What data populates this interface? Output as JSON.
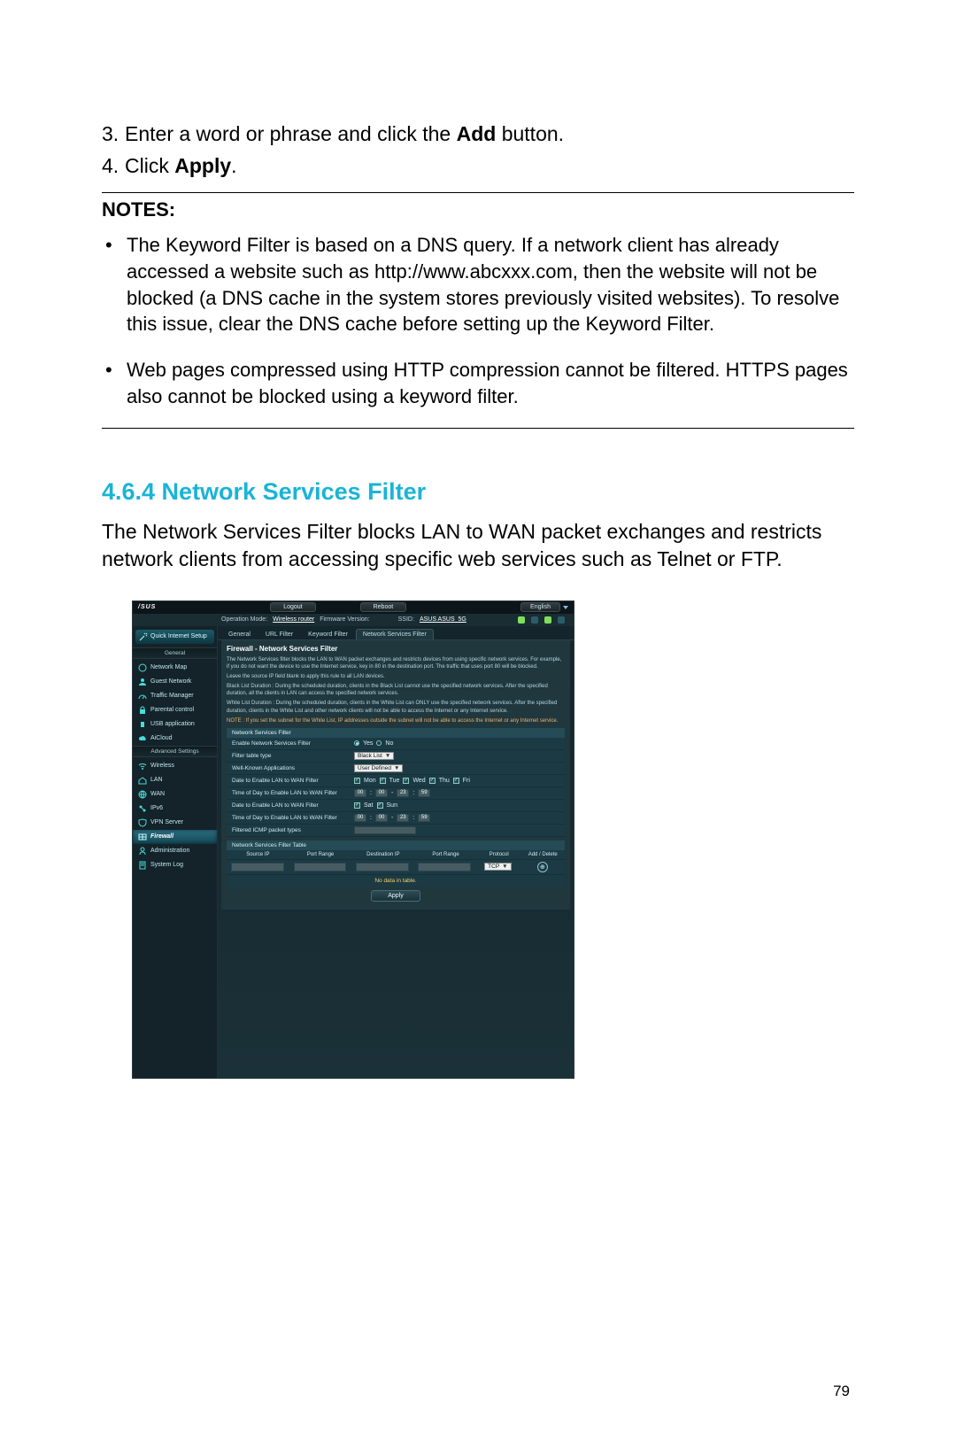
{
  "instructions": {
    "item3_num": "3.",
    "item3_pre": "Enter a word or phrase and click the ",
    "item3_bold": "Add",
    "item3_post": " button.",
    "item4_num": "4.",
    "item4_pre": "Click ",
    "item4_bold": "Apply",
    "item4_post": "."
  },
  "notes": {
    "heading": "NOTES:",
    "b1": "The Keyword Filter is based on a DNS query. If a network client has already accessed a website such as http://www.abcxxx.com, then the website will not be blocked (a DNS cache in the system stores previously visited websites). To resolve this issue, clear the DNS cache before setting up the Keyword Filter.",
    "b2": "Web pages compressed using HTTP compression cannot be filtered. HTTPS pages also cannot be blocked using a keyword filter."
  },
  "section": {
    "heading": "4.6.4 Network Services Filter",
    "body": "The Network Services Filter blocks LAN to WAN packet exchanges and restricts network clients from accessing specific web services such as Telnet or FTP."
  },
  "router": {
    "logo": "/SUS",
    "logout": "Logout",
    "reboot": "Reboot",
    "language": "English",
    "status": {
      "op_mode_lbl": "Operation Mode:",
      "op_mode_val": "Wireless router",
      "fw_lbl": "Firmware Version:",
      "ssid_lbl": "SSID:",
      "ssid_val": "ASUS  ASUS_5G"
    },
    "side": {
      "quick": "Quick Internet Setup",
      "general": "General",
      "items_general": [
        "Network Map",
        "Guest Network",
        "Traffic Manager",
        "Parental control",
        "USB application",
        "AiCloud"
      ],
      "advanced": "Advanced Settings",
      "items_adv": [
        "Wireless",
        "LAN",
        "WAN",
        "IPv6",
        "VPN Server",
        "Firewall",
        "Administration",
        "System Log"
      ]
    },
    "tabs": [
      "General",
      "URL Filter",
      "Keyword Filter",
      "Network Services Filter"
    ],
    "panel": {
      "title": "Firewall - Network Services Filter",
      "d1": "The Network Services filter blocks the LAN to WAN packet exchanges and restricts devices from using specific network services. For example, if you do not want the device to use the Internet service, key in 80 in the destination port. The traffic that uses port 80 will be blocked.",
      "d2": "Leave the source IP field blank to apply this rule to all LAN devices.",
      "d3": "Black List Duration : During the scheduled duration, clients in the Black List cannot use the specified network services. After the specified duration, all the clients in LAN can access the specified network services.",
      "d4": "White List Duration : During the scheduled duration, clients in the White List can ONLY use the specified network services. After the specified duration, clients in the White List and other network clients will not be able to access the Internet or any Internet service.",
      "d5": "NOTE : If you set the subnet for the White List, IP addresses outside the subnet will not be able to access the Internet or any Internet service."
    },
    "form": {
      "sec1": "Network Services Filter",
      "r1": "Enable Network Services Filter",
      "yes": "Yes",
      "no": "No",
      "r2": "Filter table type",
      "r2_val": "Black List",
      "r3": "Well-Known Applications",
      "r3_val": "User Defined",
      "r4": "Date to Enable LAN to WAN Filter",
      "days1": [
        "Mon",
        "Tue",
        "Wed",
        "Thu",
        "Fri"
      ],
      "r5": "Time of Day to Enable LAN to WAN Filter",
      "t1": [
        "00",
        "00",
        "23",
        "59"
      ],
      "r6": "Date to Enable LAN to WAN Filter",
      "days2": [
        "Sat",
        "Sun"
      ],
      "r7": "Time of Day to Enable LAN to WAN Filter",
      "t2": [
        "00",
        "00",
        "23",
        "59"
      ],
      "r8": "Filtered ICMP packet types"
    },
    "table": {
      "sec": "Network Services Filter Table",
      "cols": [
        "Source IP",
        "Port Range",
        "Destination IP",
        "Port Range",
        "Protocol",
        "Add / Delete"
      ],
      "proto": "TCP",
      "nodata": "No data in table.",
      "apply": "Apply"
    }
  },
  "page_no": "79"
}
